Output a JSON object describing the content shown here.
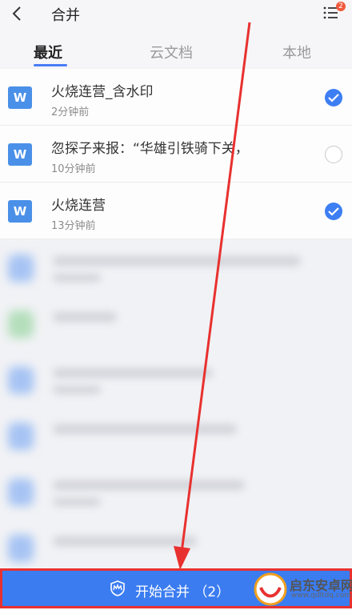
{
  "header": {
    "title": "合并",
    "menu_badge": "2"
  },
  "tabs": [
    {
      "label": "最近",
      "active": true
    },
    {
      "label": "云文档",
      "active": false
    },
    {
      "label": "本地",
      "active": false
    }
  ],
  "files": [
    {
      "icon": "word-doc-icon",
      "icon_text": "W",
      "title": "火烧连营_含水印",
      "time": "2分钟前",
      "checked": true
    },
    {
      "icon": "word-doc-icon",
      "icon_text": "W",
      "title": "忽探子来报：“华雄引铁骑下关，",
      "time": "10分钟前",
      "checked": false
    },
    {
      "icon": "word-doc-icon",
      "icon_text": "W",
      "title": "火烧连营",
      "time": "13分钟前",
      "checked": true
    }
  ],
  "bottom": {
    "label": "开始合并 （2）"
  },
  "watermark": {
    "text": "启东安卓网",
    "url": "www.qdltdq.com"
  },
  "colors": {
    "accent": "#3b7cf0",
    "highlight_border": "#e8312f",
    "arrow": "#e8312f",
    "badge": "#f05a3c"
  }
}
